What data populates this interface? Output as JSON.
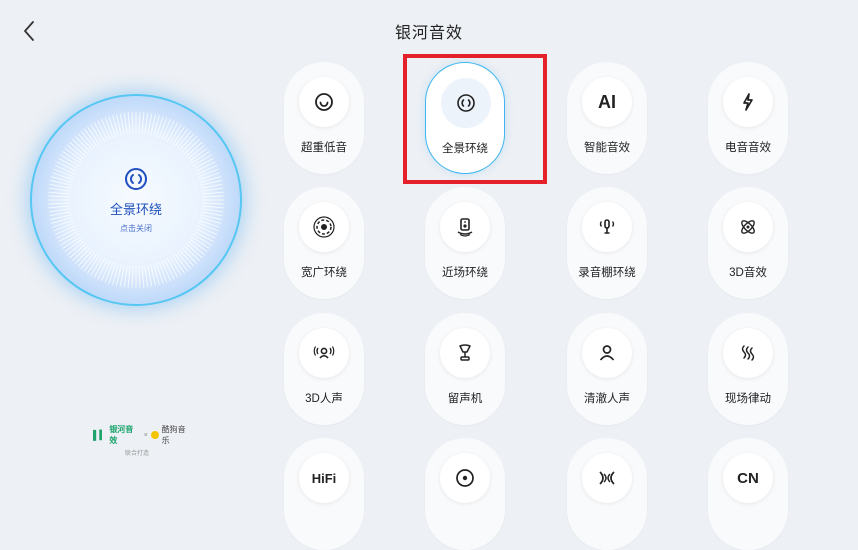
{
  "header": {
    "title": "银河音效",
    "back_icon": "chevron-left-icon"
  },
  "current_effect": {
    "label": "全景环绕",
    "sub_label": "点击关闭",
    "icon": "surround-ring-icon"
  },
  "brand": {
    "left": "银河音效",
    "separator": "×",
    "right": "酷狗音乐",
    "sub": "联合打造"
  },
  "effects": [
    {
      "label": "超重低音",
      "icon": "bass-icon",
      "active": false
    },
    {
      "label": "全景环绕",
      "icon": "surround-ring-icon",
      "active": true
    },
    {
      "label": "智能音效",
      "icon_text": "AI",
      "active": false
    },
    {
      "label": "电音音效",
      "icon": "lightning-icon",
      "active": false
    },
    {
      "label": "宽广环绕",
      "icon": "wide-surround-icon",
      "active": false
    },
    {
      "label": "近场环绕",
      "icon": "speaker-icon",
      "active": false
    },
    {
      "label": "录音棚环绕",
      "icon": "microphone-icon",
      "active": false
    },
    {
      "label": "3D音效",
      "icon": "atom-icon",
      "active": false
    },
    {
      "label": "3D人声",
      "icon": "voice-3d-icon",
      "active": false
    },
    {
      "label": "留声机",
      "icon": "gramophone-icon",
      "active": false
    },
    {
      "label": "清澈人声",
      "icon": "person-icon",
      "active": false
    },
    {
      "label": "现场律动",
      "icon": "wave-icon",
      "active": false
    },
    {
      "label": "",
      "icon_text": "HiFi",
      "active": false
    },
    {
      "label": "",
      "icon": "vinyl-icon",
      "active": false
    },
    {
      "label": "",
      "icon": "dolby-like-icon",
      "active": false
    },
    {
      "label": "",
      "icon_text": "CN",
      "active": false
    }
  ]
}
